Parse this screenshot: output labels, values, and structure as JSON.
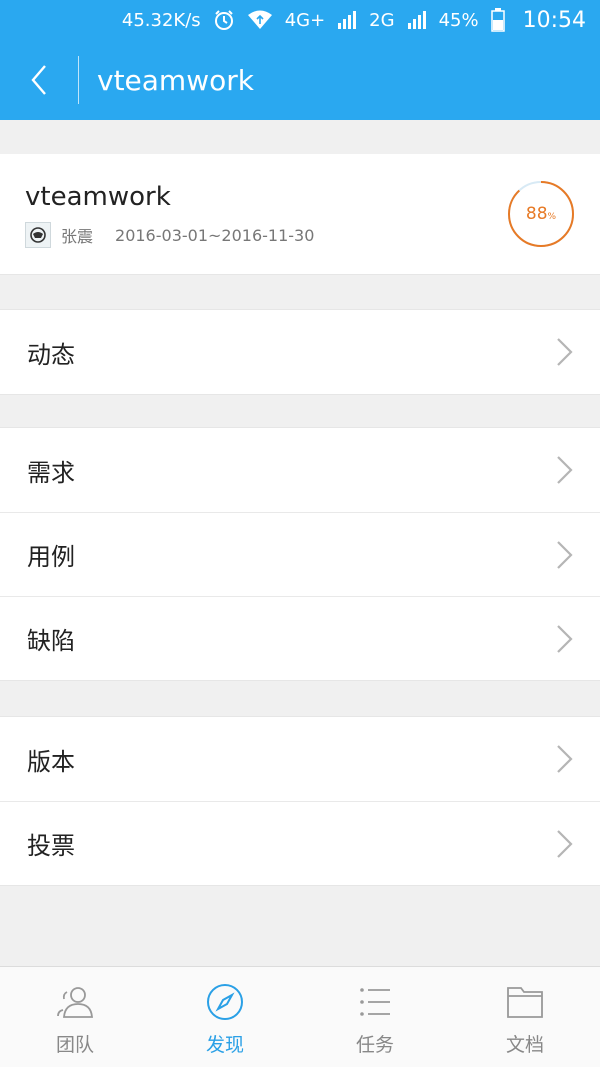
{
  "status_bar": {
    "net_speed": "45.32K/s",
    "network1": "4G+",
    "network2": "2G",
    "battery": "45%",
    "time": "10:54"
  },
  "header": {
    "title": "vteamwork"
  },
  "project": {
    "name": "vteamwork",
    "owner": "张震",
    "date_range": "2016-03-01~2016-11-30",
    "progress_value": "88",
    "progress_unit": "%",
    "progress_fraction": 0.88
  },
  "menu_groups": [
    {
      "items": [
        {
          "label": "动态"
        }
      ]
    },
    {
      "items": [
        {
          "label": "需求"
        },
        {
          "label": "用例"
        },
        {
          "label": "缺陷"
        }
      ]
    },
    {
      "items": [
        {
          "label": "版本"
        },
        {
          "label": "投票"
        }
      ]
    }
  ],
  "tabs": [
    {
      "label": "团队",
      "icon": "team-icon"
    },
    {
      "label": "发现",
      "icon": "compass-icon"
    },
    {
      "label": "任务",
      "icon": "list-icon"
    },
    {
      "label": "文档",
      "icon": "folder-icon"
    }
  ],
  "colors": {
    "primary": "#2aa8f0",
    "progress": "#e77a26",
    "active_tab": "#2aa0e6"
  }
}
